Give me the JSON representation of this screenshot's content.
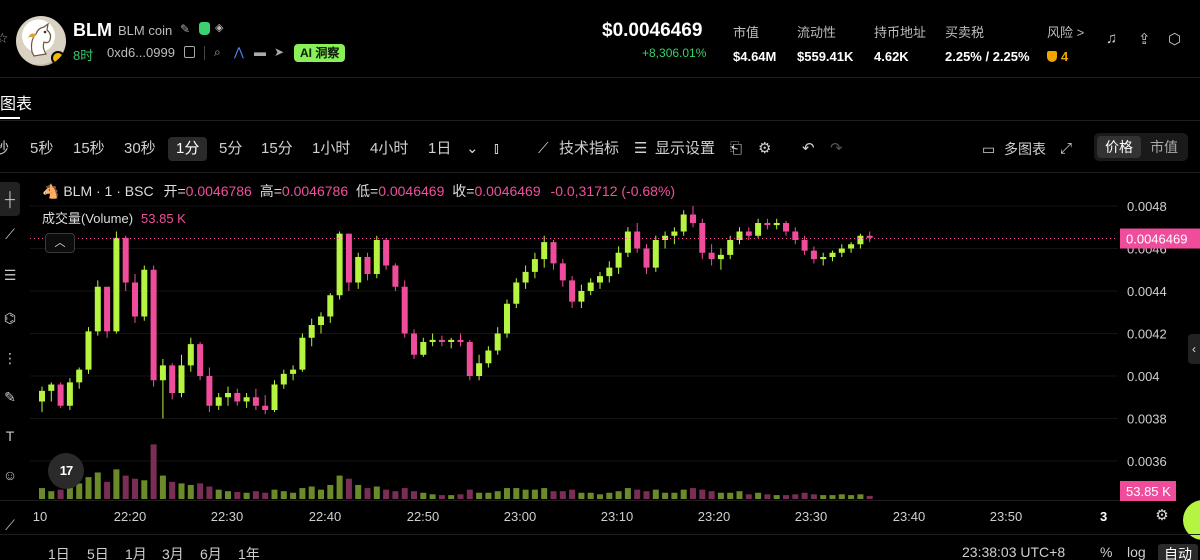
{
  "token": {
    "symbol": "BLM",
    "full_name": "BLM coin",
    "age": "8时",
    "address": "0xd6...0999",
    "ai_badge": "AI 洞察"
  },
  "price": {
    "value": "$0.0046469",
    "change": "+8,306.01%"
  },
  "stats": [
    {
      "label": "市值",
      "value": "$4.64M"
    },
    {
      "label": "流动性",
      "value": "$559.41K"
    },
    {
      "label": "持币地址",
      "value": "4.62K"
    },
    {
      "label": "买卖税",
      "value": "2.25% / 2.25%"
    }
  ],
  "risk": {
    "label": "风险 >",
    "value": "4"
  },
  "section_tab": "图表",
  "toolbar": {
    "intervals": [
      "秒",
      "5秒",
      "15秒",
      "30秒",
      "1分",
      "5分",
      "15分",
      "1小时",
      "4小时",
      "1日"
    ],
    "active_interval": "1分",
    "indicators": "技术指标",
    "display_settings": "显示设置",
    "multi_chart": "多图表",
    "price_mode": "价格",
    "mcap_mode": "市值"
  },
  "legend": {
    "title": "BLM · 1 · BSC",
    "open_label": "开=",
    "open": "0.0046786",
    "high_label": "高=",
    "high": "0.0046786",
    "low_label": "低=",
    "low": "0.0046469",
    "close_label": "收=",
    "close": "0.0046469",
    "change": "-0.0,31712 (-0.68%)",
    "volume_label": "成交量(Volume)",
    "volume": "53.85 K"
  },
  "colors": {
    "up": "#b5f542",
    "down": "#ef4d9b",
    "vol_up": "#6b8a2a",
    "vol_down": "#7a2d55",
    "price_tag": "#ef4d9b"
  },
  "chart_data": {
    "type": "candlestick",
    "y_ticks": [
      "0.0048",
      "0.0046",
      "0.0044",
      "0.0042",
      "0.004",
      "0.0038",
      "0.0036"
    ],
    "ylim": [
      0.00343,
      0.0049
    ],
    "x_ticks": [
      "10",
      "22:20",
      "22:30",
      "22:40",
      "22:50",
      "23:00",
      "23:10",
      "23:20",
      "23:30",
      "23:40",
      "23:50"
    ],
    "last_price_label": "0.0046469",
    "last_price": 0.0046469,
    "volume_label": "53.85 K",
    "start_minute": 0,
    "candles": [
      [
        0.00388,
        0.00395,
        0.00383,
        0.00393,
        14
      ],
      [
        0.00393,
        0.00397,
        0.00388,
        0.00396,
        10
      ],
      [
        0.00396,
        0.00397,
        0.00385,
        0.00386,
        12
      ],
      [
        0.00386,
        0.00399,
        0.00384,
        0.00397,
        16
      ],
      [
        0.00397,
        0.00404,
        0.00394,
        0.00403,
        20
      ],
      [
        0.00403,
        0.00423,
        0.00401,
        0.00421,
        28
      ],
      [
        0.00421,
        0.00445,
        0.00419,
        0.00442,
        34
      ],
      [
        0.00442,
        0.00435,
        0.00418,
        0.00421,
        22
      ],
      [
        0.00421,
        0.00468,
        0.0042,
        0.00465,
        38
      ],
      [
        0.00465,
        0.00466,
        0.0044,
        0.00444,
        30
      ],
      [
        0.00444,
        0.00448,
        0.00425,
        0.00428,
        26
      ],
      [
        0.00428,
        0.00452,
        0.00426,
        0.0045,
        24
      ],
      [
        0.0045,
        0.00452,
        0.00395,
        0.00398,
        70
      ],
      [
        0.00398,
        0.00408,
        0.0038,
        0.00405,
        30
      ],
      [
        0.00405,
        0.00406,
        0.00389,
        0.00392,
        22
      ],
      [
        0.00392,
        0.0041,
        0.0039,
        0.00405,
        20
      ],
      [
        0.00405,
        0.00418,
        0.00402,
        0.00415,
        18
      ],
      [
        0.00415,
        0.00416,
        0.00398,
        0.004,
        20
      ],
      [
        0.004,
        0.00404,
        0.00383,
        0.00386,
        16
      ],
      [
        0.00386,
        0.00392,
        0.00384,
        0.0039,
        12
      ],
      [
        0.0039,
        0.00395,
        0.00386,
        0.00392,
        10
      ],
      [
        0.00392,
        0.00394,
        0.00386,
        0.00388,
        9
      ],
      [
        0.00388,
        0.00392,
        0.00385,
        0.0039,
        8
      ],
      [
        0.0039,
        0.00394,
        0.00384,
        0.00386,
        10
      ],
      [
        0.00386,
        0.00391,
        0.00382,
        0.00384,
        8
      ],
      [
        0.00384,
        0.00398,
        0.00383,
        0.00396,
        12
      ],
      [
        0.00396,
        0.00403,
        0.00394,
        0.00401,
        10
      ],
      [
        0.00401,
        0.00405,
        0.00398,
        0.00403,
        8
      ],
      [
        0.00403,
        0.0042,
        0.00402,
        0.00418,
        14
      ],
      [
        0.00418,
        0.00427,
        0.00414,
        0.00424,
        16
      ],
      [
        0.00424,
        0.0043,
        0.0042,
        0.00428,
        12
      ],
      [
        0.00428,
        0.00439,
        0.00425,
        0.00438,
        18
      ],
      [
        0.00438,
        0.00468,
        0.00436,
        0.00467,
        30
      ],
      [
        0.00467,
        0.00466,
        0.0044,
        0.00444,
        26
      ],
      [
        0.00444,
        0.00458,
        0.00441,
        0.00456,
        18
      ],
      [
        0.00456,
        0.00458,
        0.00445,
        0.00448,
        14
      ],
      [
        0.00448,
        0.00466,
        0.00446,
        0.00464,
        16
      ],
      [
        0.00464,
        0.00465,
        0.0045,
        0.00452,
        12
      ],
      [
        0.00452,
        0.00453,
        0.0044,
        0.00442,
        10
      ],
      [
        0.00442,
        0.00445,
        0.00418,
        0.0042,
        14
      ],
      [
        0.0042,
        0.00422,
        0.00408,
        0.0041,
        10
      ],
      [
        0.0041,
        0.00418,
        0.00409,
        0.00416,
        8
      ],
      [
        0.00416,
        0.0042,
        0.00414,
        0.00417,
        6
      ],
      [
        0.00417,
        0.00419,
        0.00414,
        0.00416,
        5
      ],
      [
        0.00416,
        0.00418,
        0.00413,
        0.00417,
        5
      ],
      [
        0.00417,
        0.0042,
        0.00414,
        0.00416,
        6
      ],
      [
        0.00416,
        0.00417,
        0.00398,
        0.004,
        12
      ],
      [
        0.004,
        0.0041,
        0.00398,
        0.00406,
        8
      ],
      [
        0.00406,
        0.00414,
        0.00404,
        0.00412,
        8
      ],
      [
        0.00412,
        0.00423,
        0.0041,
        0.0042,
        10
      ],
      [
        0.0042,
        0.00436,
        0.00418,
        0.00434,
        14
      ],
      [
        0.00434,
        0.00446,
        0.00432,
        0.00444,
        14
      ],
      [
        0.00444,
        0.00452,
        0.00441,
        0.00449,
        12
      ],
      [
        0.00449,
        0.00458,
        0.00446,
        0.00455,
        12
      ],
      [
        0.00455,
        0.00466,
        0.00451,
        0.00463,
        14
      ],
      [
        0.00463,
        0.00464,
        0.0045,
        0.00453,
        10
      ],
      [
        0.00453,
        0.00455,
        0.00442,
        0.00445,
        10
      ],
      [
        0.00445,
        0.00447,
        0.00432,
        0.00435,
        12
      ],
      [
        0.00435,
        0.00443,
        0.00432,
        0.0044,
        8
      ],
      [
        0.0044,
        0.00446,
        0.00438,
        0.00444,
        8
      ],
      [
        0.00444,
        0.00449,
        0.00441,
        0.00447,
        6
      ],
      [
        0.00447,
        0.00454,
        0.00444,
        0.00451,
        8
      ],
      [
        0.00451,
        0.00461,
        0.00448,
        0.00458,
        10
      ],
      [
        0.00458,
        0.0047,
        0.00456,
        0.00468,
        14
      ],
      [
        0.00468,
        0.00472,
        0.00458,
        0.0046,
        12
      ],
      [
        0.0046,
        0.00462,
        0.00448,
        0.00451,
        10
      ],
      [
        0.00451,
        0.00466,
        0.00449,
        0.00464,
        12
      ],
      [
        0.00464,
        0.00468,
        0.0046,
        0.00466,
        8
      ],
      [
        0.00466,
        0.0047,
        0.00462,
        0.00468,
        8
      ],
      [
        0.00468,
        0.00478,
        0.00466,
        0.00476,
        12
      ],
      [
        0.00476,
        0.0048,
        0.0047,
        0.00472,
        14
      ],
      [
        0.00472,
        0.00474,
        0.00455,
        0.00458,
        12
      ],
      [
        0.00458,
        0.00462,
        0.00452,
        0.00455,
        10
      ],
      [
        0.00455,
        0.0046,
        0.0045,
        0.00457,
        8
      ],
      [
        0.00457,
        0.00466,
        0.00455,
        0.00464,
        8
      ],
      [
        0.00464,
        0.0047,
        0.00462,
        0.00468,
        10
      ],
      [
        0.00468,
        0.0047,
        0.00464,
        0.00466,
        6
      ],
      [
        0.00466,
        0.00474,
        0.00465,
        0.00472,
        8
      ],
      [
        0.00472,
        0.00474,
        0.00469,
        0.00471,
        6
      ],
      [
        0.00471,
        0.00474,
        0.00469,
        0.00472,
        5
      ],
      [
        0.00472,
        0.00473,
        0.00466,
        0.00468,
        5
      ],
      [
        0.00468,
        0.0047,
        0.00462,
        0.00464,
        6
      ],
      [
        0.00464,
        0.00466,
        0.00457,
        0.00459,
        8
      ],
      [
        0.00459,
        0.00461,
        0.00453,
        0.00455,
        6
      ],
      [
        0.00455,
        0.00458,
        0.00452,
        0.00456,
        5
      ],
      [
        0.00456,
        0.00459,
        0.00454,
        0.00458,
        5
      ],
      [
        0.00458,
        0.00462,
        0.00456,
        0.0046,
        6
      ],
      [
        0.0046,
        0.00463,
        0.00458,
        0.00462,
        5
      ],
      [
        0.00462,
        0.00467,
        0.0046,
        0.00466,
        6
      ],
      [
        0.00466,
        0.00468,
        0.00463,
        0.00465,
        4
      ]
    ]
  },
  "bottom": {
    "ranges": [
      "1日",
      "5日",
      "1月",
      "3月",
      "6月",
      "1年"
    ],
    "clock": "23:38:03 UTC+8",
    "percent": "%",
    "log": "log",
    "auto": "自动",
    "three": "3"
  }
}
